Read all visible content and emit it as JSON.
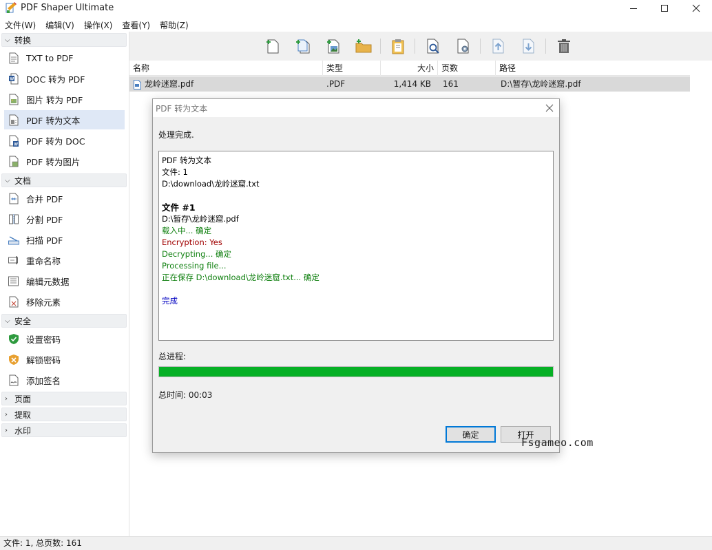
{
  "window": {
    "title": "PDF Shaper Ultimate"
  },
  "menu": [
    "文件(W)",
    "编辑(V)",
    "操作(X)",
    "查看(Y)",
    "帮助(Z)"
  ],
  "sidebar": {
    "groups": [
      {
        "label": "转换",
        "expanded": true
      },
      {
        "label": "文档",
        "expanded": true
      },
      {
        "label": "安全",
        "expanded": true
      },
      {
        "label": "页面",
        "expanded": false
      },
      {
        "label": "提取",
        "expanded": false
      },
      {
        "label": "水印",
        "expanded": false
      }
    ],
    "items": [
      {
        "label": "TXT to PDF",
        "icon": "txt-doc-icon"
      },
      {
        "label": "DOC 转为 PDF",
        "icon": "word-doc-icon"
      },
      {
        "label": "图片 转为 PDF",
        "icon": "image-doc-icon"
      },
      {
        "label": "PDF 转为文本",
        "icon": "pdf-text-icon",
        "selected": true
      },
      {
        "label": "PDF 转为 DOC",
        "icon": "pdf-word-icon"
      },
      {
        "label": "PDF 转为图片",
        "icon": "pdf-image-icon"
      },
      {
        "label": "合并 PDF",
        "icon": "merge-icon"
      },
      {
        "label": "分割 PDF",
        "icon": "split-icon"
      },
      {
        "label": "扫描 PDF",
        "icon": "scanner-icon"
      },
      {
        "label": "重命名称",
        "icon": "rename-icon"
      },
      {
        "label": "编辑元数据",
        "icon": "metadata-icon"
      },
      {
        "label": "移除元素",
        "icon": "remove-elements-icon"
      },
      {
        "label": "设置密码",
        "icon": "shield-check-icon"
      },
      {
        "label": "解锁密码",
        "icon": "shield-x-icon"
      },
      {
        "label": "添加签名",
        "icon": "signature-icon"
      }
    ]
  },
  "toolbar": {
    "buttons": [
      "add-file-icon",
      "add-files-icon",
      "add-image-icon",
      "add-folder-icon",
      "clipboard-icon",
      "preview-icon",
      "settings-icon",
      "move-up-icon",
      "move-down-icon",
      "delete-icon"
    ]
  },
  "filelist": {
    "columns": [
      "名称",
      "类型",
      "大小",
      "页数",
      "路径"
    ],
    "rows": [
      {
        "name": "龙岭迷窟.pdf",
        "type": ".PDF",
        "size": "1,414 KB",
        "pages": "161",
        "path": "D:\\暂存\\龙岭迷窟.pdf"
      }
    ]
  },
  "statusbar": {
    "text": "文件: 1, 总页数: 161"
  },
  "dialog": {
    "title": "PDF 转为文本",
    "status": "处理完成.",
    "log": [
      {
        "text": "PDF 转为文本",
        "color": "black"
      },
      {
        "text": "文件: 1",
        "color": "black"
      },
      {
        "text": "D:\\download\\龙岭迷窟.txt",
        "color": "black"
      },
      {
        "text": "",
        "color": "black"
      },
      {
        "text": "文件 #1",
        "color": "black",
        "bold": true
      },
      {
        "text": "D:\\暂存\\龙岭迷窟.pdf",
        "color": "black"
      },
      {
        "text": "载入中... 确定",
        "color": "green"
      },
      {
        "text": "Encryption: Yes",
        "color": "red"
      },
      {
        "text": "Decrypting... 确定",
        "color": "green"
      },
      {
        "text": "Processing file...",
        "color": "green"
      },
      {
        "text": "正在保存 D:\\download\\龙岭迷窟.txt... 确定",
        "color": "green"
      },
      {
        "text": "",
        "color": "black"
      },
      {
        "text": "完成",
        "color": "blue"
      }
    ],
    "progress_label": "总进程:",
    "progress": 1.0,
    "time_label": "总时间: 00:03",
    "ok_label": "确定",
    "open_label": "打开"
  },
  "watermark": "Fsgameo.com",
  "colors": {
    "progress": "#06b025",
    "selected": "#dfe8f6",
    "accent": "#0078d7"
  }
}
